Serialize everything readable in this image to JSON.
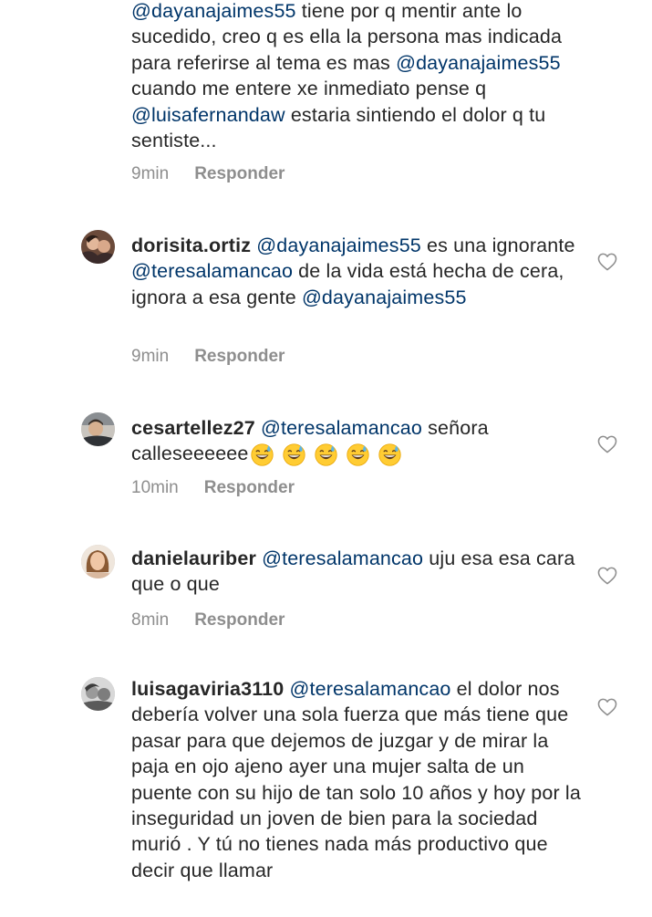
{
  "comments": [
    {
      "username": "",
      "segments": [
        {
          "type": "mention",
          "text": "@dayanajaimes55"
        },
        {
          "type": "text",
          "text": " tiene por q mentir ante lo sucedido, creo q es ella la persona mas indicada para referirse al tema es mas "
        },
        {
          "type": "mention",
          "text": "@dayanajaimes55"
        },
        {
          "type": "text",
          "text": "  cuando me entere xe inmediato pense q "
        },
        {
          "type": "mention",
          "text": "@luisafernandaw"
        },
        {
          "type": "text",
          "text": " estaria sintiendo el dolor q tu sentiste..."
        }
      ],
      "time": "9min",
      "reply_label": "Responder"
    },
    {
      "username": "dorisita.ortiz",
      "segments": [
        {
          "type": "mention",
          "text": "@dayanajaimes55"
        },
        {
          "type": "text",
          "text": " es una ignorante "
        },
        {
          "type": "mention",
          "text": "@teresalamancao"
        },
        {
          "type": "text",
          "text": " de la vida está hecha de cera, ignora a esa gente "
        },
        {
          "type": "mention",
          "text": "@dayanajaimes55"
        }
      ],
      "time": "9min",
      "reply_label": "Responder"
    },
    {
      "username": "cesartellez27",
      "segments": [
        {
          "type": "mention",
          "text": "@teresalamancao"
        },
        {
          "type": "text",
          "text": " señora calleseeeeee"
        }
      ],
      "emoji": "grinning-face-with-sweat",
      "emoji_count": 5,
      "time": "10min",
      "reply_label": "Responder"
    },
    {
      "username": "danielauriber",
      "segments": [
        {
          "type": "mention",
          "text": "@teresalamancao"
        },
        {
          "type": "text",
          "text": " uju esa esa cara que o que"
        }
      ],
      "time": "8min",
      "reply_label": "Responder"
    },
    {
      "username": "luisagaviria3110",
      "segments": [
        {
          "type": "mention",
          "text": "@teresalamancao"
        },
        {
          "type": "text",
          "text": " el dolor nos debería volver una sola fuerza que más tiene que pasar para que dejemos de juzgar y de mirar la paja en ojo ajeno ayer una mujer salta de un puente con su hijo de tan solo 10 años y hoy por la inseguridad un joven de bien para la sociedad murió . Y tú no tienes nada más productivo que decir que llamar"
        }
      ],
      "time": "",
      "reply_label": ""
    }
  ],
  "icons": {
    "like": "heart-outline-icon",
    "emoji": "grinning-face-with-sweat-emoji"
  },
  "colors": {
    "text": "#262626",
    "mention": "#003569",
    "meta": "#8e8e8e",
    "heart": "#8e8e8e"
  }
}
